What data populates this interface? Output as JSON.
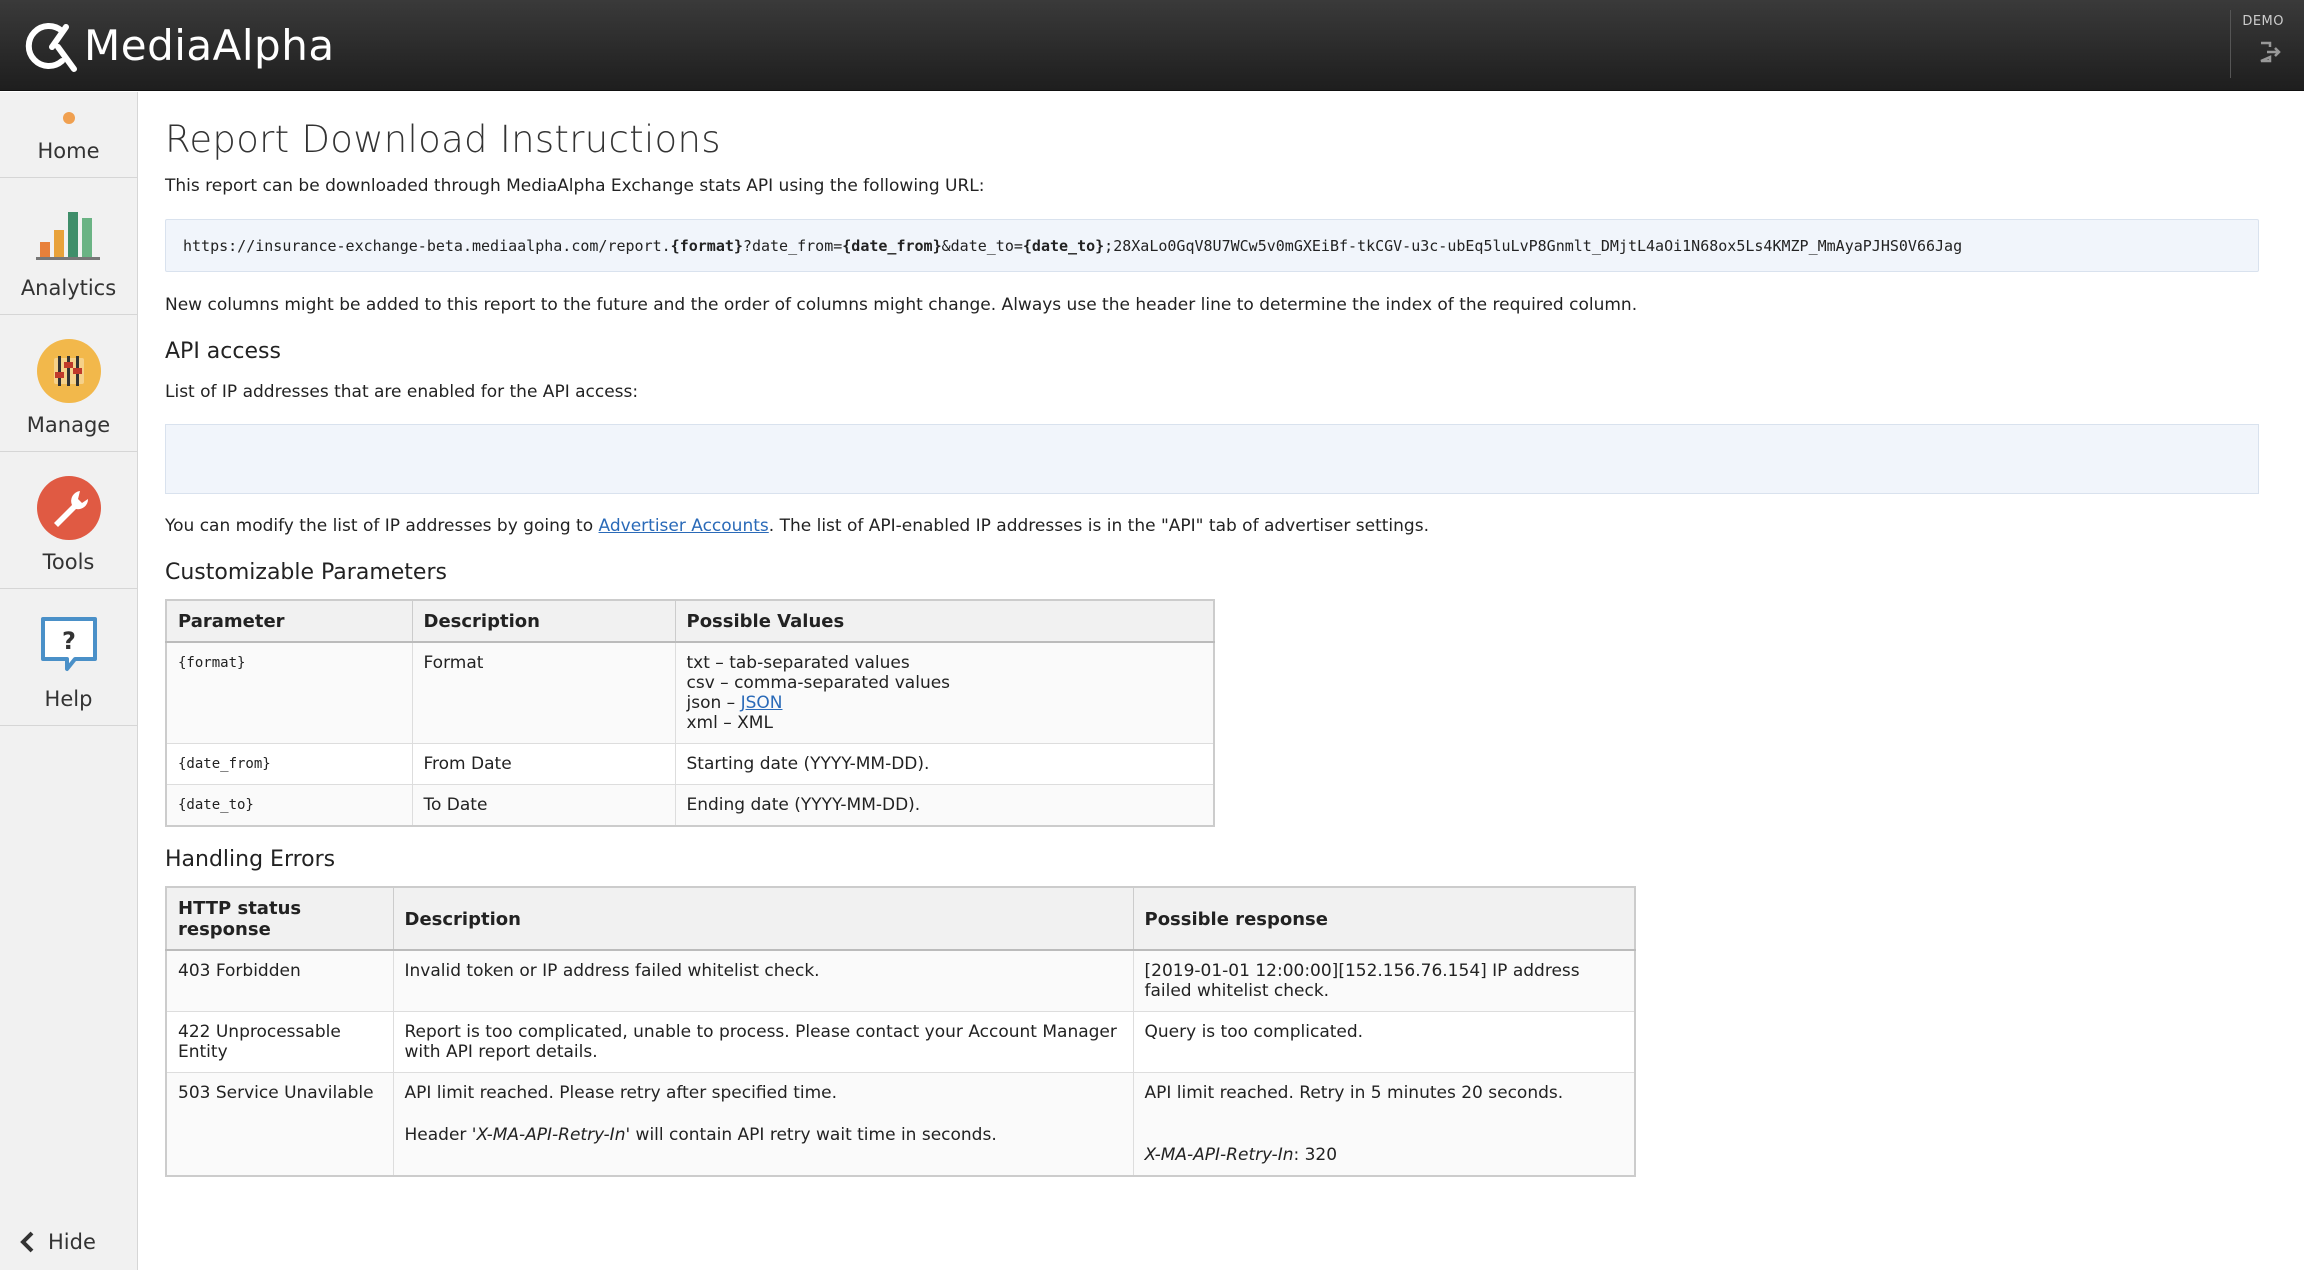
{
  "header": {
    "brand": "MediaAlpha",
    "account_label": "DEMO"
  },
  "sidebar": {
    "items": [
      {
        "label": "Home",
        "icon": "home-icon"
      },
      {
        "label": "Analytics",
        "icon": "bar-chart-icon"
      },
      {
        "label": "Manage",
        "icon": "sliders-icon"
      },
      {
        "label": "Tools",
        "icon": "wrench-icon"
      },
      {
        "label": "Help",
        "icon": "question-icon"
      }
    ],
    "hide_label": "Hide"
  },
  "main": {
    "title": "Report Download Instructions",
    "intro": "This report can be downloaded through MediaAlpha Exchange stats API using the following URL:",
    "url": {
      "prefix": "https://insurance-exchange-beta.mediaalpha.com/report.",
      "format_token": "{format}",
      "part2": "?date_from=",
      "from_token": "{date_from}",
      "part3": "&date_to=",
      "to_token": "{date_to}",
      "suffix": ";28XaLo0GqV8U7WCw5v0mGXEiBf-tkCGV-u3c-ubEq5luLvP8Gnmlt_DMjtL4aOi1N68ox5Ls4KMZP_MmAyaPJHS0V66Jag"
    },
    "columns_note": "New columns might be added to this report to the future and the order of columns might change. Always use the header line to determine the index of the required column.",
    "api_heading": "API access",
    "ip_intro": "List of IP addresses that are enabled for the API access:",
    "modify_prefix": "You can modify the list of IP addresses by going to ",
    "modify_link": "Advertiser Accounts",
    "modify_suffix": ". The list of API-enabled IP addresses is in the \"API\" tab of advertiser settings.",
    "params_heading": "Customizable Parameters",
    "params_table": {
      "headers": [
        "Parameter",
        "Description",
        "Possible Values"
      ],
      "rows": [
        {
          "param": "{format}",
          "desc": "Format",
          "values": [
            "txt – tab-separated values",
            "csv – comma-separated values",
            "json – ",
            "xml – XML"
          ],
          "json_link": "JSON"
        },
        {
          "param": "{date_from}",
          "desc": "From Date",
          "values": [
            "Starting date (YYYY-MM-DD)."
          ]
        },
        {
          "param": "{date_to}",
          "desc": "To Date",
          "values": [
            "Ending date (YYYY-MM-DD)."
          ]
        }
      ]
    },
    "errors_heading": "Handling Errors",
    "errors_table": {
      "headers": [
        "HTTP status response",
        "Description",
        "Possible response"
      ],
      "rows": [
        {
          "status": "403 Forbidden",
          "desc": "Invalid token or IP address failed whitelist check.",
          "response": "[2019-01-01 12:00:00][152.156.76.154] IP address failed whitelist check."
        },
        {
          "status": "422 Unprocessable Entity",
          "desc": "Report is too complicated, unable to process. Please contact your Account Manager with API report details.",
          "response": "Query is too complicated."
        },
        {
          "status": "503 Service Unavilable",
          "desc": "API limit reached. Please retry after specified time.",
          "desc2_prefix": "Header '",
          "desc2_italic": "X-MA-API-Retry-In",
          "desc2_suffix": "' will contain API retry wait time in seconds.",
          "response": "API limit reached. Retry in 5 minutes 20 seconds.",
          "response2_italic": "X-MA-API-Retry-In",
          "response2_suffix": ": 320"
        }
      ]
    }
  },
  "colors": {
    "topbar": "#2a2a2a",
    "sidebar": "#f1f1f1",
    "code_bg": "#f1f5fb",
    "link": "#2a6ab8",
    "manage_icon": "#f2b84b",
    "tools_icon": "#e05a43",
    "help_icon": "#4a90c8"
  }
}
